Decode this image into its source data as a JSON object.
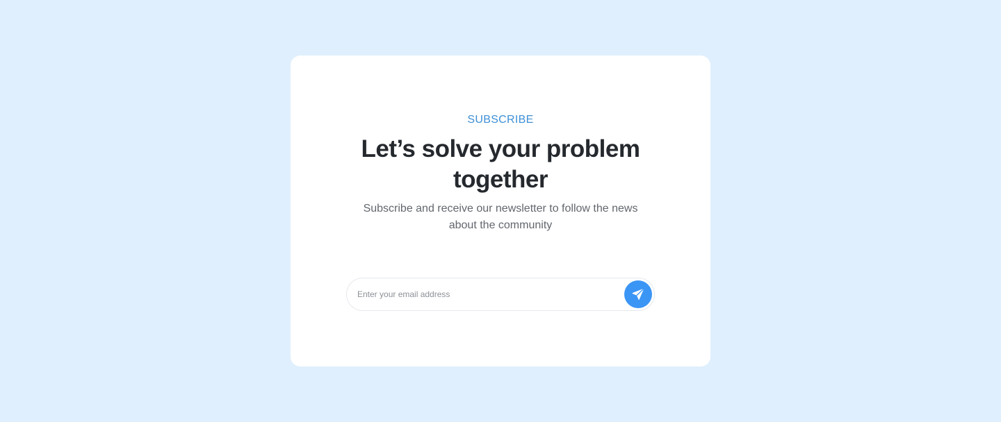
{
  "subscribe": {
    "eyebrow": "SUBSCRIBE",
    "headline_line1": "Let’s solve your problem",
    "headline_line2": "together",
    "description_line1": "Subscribe and receive our newsletter to follow the news",
    "description_line2": "about the community",
    "email_placeholder": "Enter your email address",
    "email_value": "",
    "submit_icon": "send-icon"
  },
  "colors": {
    "page_background": "#e0effd",
    "card_background": "#ffffff",
    "accent": "#3d8fd6",
    "button": "#3b95f5",
    "headline": "#25292e",
    "body_text": "#62666c"
  }
}
